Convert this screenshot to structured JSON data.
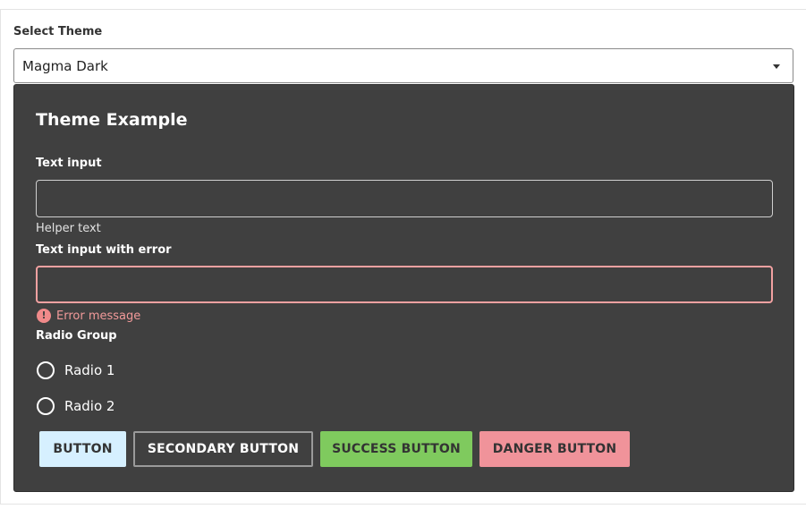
{
  "theme_select": {
    "label": "Select Theme",
    "value": "Magma Dark"
  },
  "panel": {
    "title": "Theme Example",
    "text_input": {
      "label": "Text input",
      "value": "",
      "helper": "Helper text"
    },
    "error_input": {
      "label": "Text input with error",
      "value": "",
      "error_icon": "!",
      "error": "Error message"
    },
    "radio_group": {
      "label": "Radio Group",
      "options": [
        "Radio 1",
        "Radio 2"
      ]
    },
    "buttons": {
      "primary": "BUTTON",
      "secondary": "SECONDARY BUTTON",
      "success": "SUCCESS BUTTON",
      "danger": "DANGER BUTTON"
    }
  },
  "colors": {
    "panel_bg": "#404040",
    "error": "#f29a9a",
    "primary_btn": "#d6f0ff",
    "success_btn": "#7fca5e",
    "danger_btn": "#f0939a"
  },
  "icons": {
    "select_arrow": "caret-down-icon",
    "error": "exclamation-circle-icon"
  }
}
